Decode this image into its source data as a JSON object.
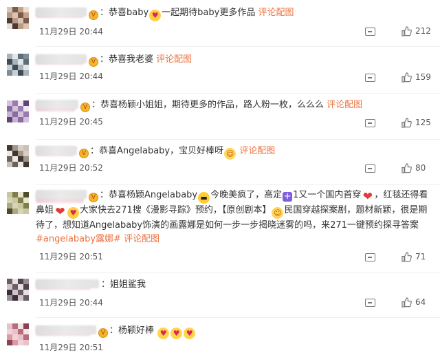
{
  "comments": [
    {
      "segments": [
        {
          "t": "text",
          "v": "：恭喜baby"
        },
        {
          "t": "emoji",
          "icon": "smile-heart-emoji"
        },
        {
          "t": "text",
          "v": "一起期待baby更多作品 "
        },
        {
          "t": "link",
          "v": "评论配图"
        }
      ],
      "time": "11月29日 20:44",
      "likes": "212"
    },
    {
      "segments": [
        {
          "t": "text",
          "v": "：恭喜我老婆 "
        },
        {
          "t": "link",
          "v": "评论配图"
        }
      ],
      "time": "11月29日 20:44",
      "likes": "159"
    },
    {
      "segments": [
        {
          "t": "text",
          "v": "：恭喜杨颖小姐姐，期待更多的作品，路人粉一枚，么么么 "
        },
        {
          "t": "link",
          "v": "评论配图"
        }
      ],
      "time": "11月29日 20:45",
      "likes": "125"
    },
    {
      "segments": [
        {
          "t": "text",
          "v": "：恭喜Angelababy，宝贝好棒呀"
        },
        {
          "t": "emoji",
          "icon": "grin-emoji"
        },
        {
          "t": "text",
          "v": " "
        },
        {
          "t": "link",
          "v": "评论配图"
        }
      ],
      "time": "11月29日 20:52",
      "likes": "80"
    },
    {
      "segments": [
        {
          "t": "text",
          "v": "：恭喜杨颖Angelababy"
        },
        {
          "t": "emoji",
          "icon": "cool-emoji"
        },
        {
          "t": "text",
          "v": "今晚美疯了，高定"
        },
        {
          "t": "emoji",
          "icon": "plus-emoji"
        },
        {
          "t": "text",
          "v": "1又一个国内首穿"
        },
        {
          "t": "emoji",
          "icon": "red-heart-emoji"
        },
        {
          "t": "text",
          "v": "，红毯还得看鼻姐"
        },
        {
          "t": "emoji",
          "icon": "red-heart-emoji"
        },
        {
          "t": "emoji",
          "icon": "smile-heart-emoji"
        },
        {
          "t": "text",
          "v": "大家快去271搜《漫影寻踪》预约，【原创剧本】"
        },
        {
          "t": "emoji",
          "icon": "grin-emoji"
        },
        {
          "t": "text",
          "v": "民国穿越探案剧，题材新颖，很是期待了，想知道Angelababy饰演的画露娜是如何一步一步揭晓迷雾的吗，来271一键预约探寻答案"
        },
        {
          "t": "tag",
          "v": "#angelababy露娜#"
        },
        {
          "t": "text",
          "v": " "
        },
        {
          "t": "link",
          "v": "评论配图"
        }
      ],
      "time": "11月29日 20:51",
      "likes": "71"
    },
    {
      "segments": [
        {
          "t": "text",
          "v": "：姐姐鲨我"
        }
      ],
      "time": "11月29日 20:44",
      "likes": "64"
    },
    {
      "segments": [
        {
          "t": "text",
          "v": "：杨颖好棒 "
        },
        {
          "t": "emoji",
          "icon": "heart-eyes-emoji"
        },
        {
          "t": "emoji",
          "icon": "heart-eyes-emoji"
        },
        {
          "t": "emoji",
          "icon": "heart-eyes-emoji"
        }
      ],
      "time": "11月29日 20:51",
      "likes": "48"
    }
  ],
  "icons": {
    "reply": "comment-icon",
    "like": "thumbs-up-icon",
    "vip": "vip-badge-icon"
  },
  "colors": {
    "link": "#eb7340",
    "meta": "#555555"
  }
}
